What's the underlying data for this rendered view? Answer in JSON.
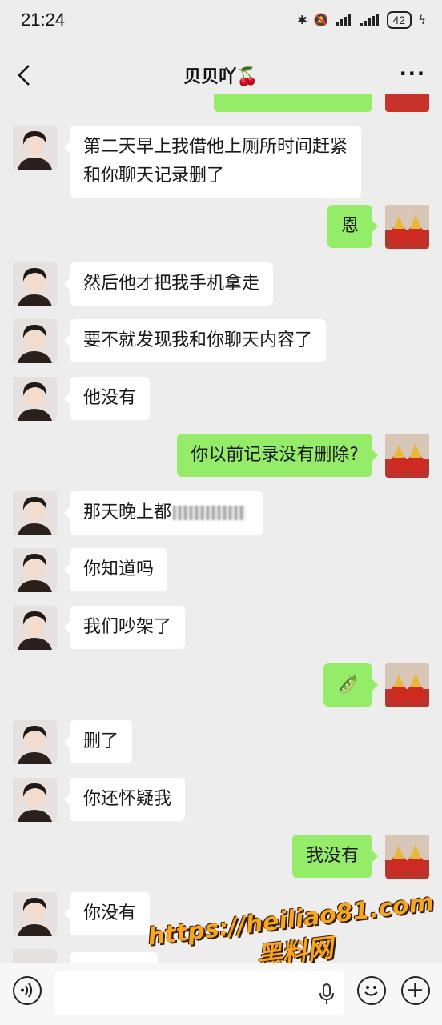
{
  "status_bar": {
    "time": "21:24",
    "battery": "42"
  },
  "header": {
    "title": "贝贝吖🍒"
  },
  "messages": [
    {
      "side": "left",
      "text": "第二天早上我借他上厕所时间赶紧\n和你聊天记录删了"
    },
    {
      "side": "right",
      "text": "恩"
    },
    {
      "side": "left",
      "text": "然后他才把我手机拿走"
    },
    {
      "side": "left",
      "text": "要不就发现我和你聊天内容了"
    },
    {
      "side": "left",
      "text": "他没有"
    },
    {
      "side": "right",
      "text": "你以前记录没有删除?"
    },
    {
      "side": "left",
      "text": "那天晚上都"
    },
    {
      "side": "left",
      "text": "你知道吗"
    },
    {
      "side": "left",
      "text": "我们吵架了"
    },
    {
      "side": "right",
      "text": "🫛"
    },
    {
      "side": "left",
      "text": "删了"
    },
    {
      "side": "left",
      "text": "你还怀疑我"
    },
    {
      "side": "right",
      "text": "我没有"
    },
    {
      "side": "left",
      "text": "你没有"
    }
  ],
  "watermark": {
    "url": "https://heiliao81.com",
    "name": "黑料网"
  },
  "icons": {
    "back": "chevron-left-icon",
    "more": "more-dots-icon",
    "voice": "voice-icon",
    "mic": "mic-icon",
    "emoji": "emoji-icon",
    "plus": "plus-icon"
  },
  "colors": {
    "background": "#ededed",
    "bubble_right": "#95ec69",
    "bubble_left": "#ffffff"
  }
}
